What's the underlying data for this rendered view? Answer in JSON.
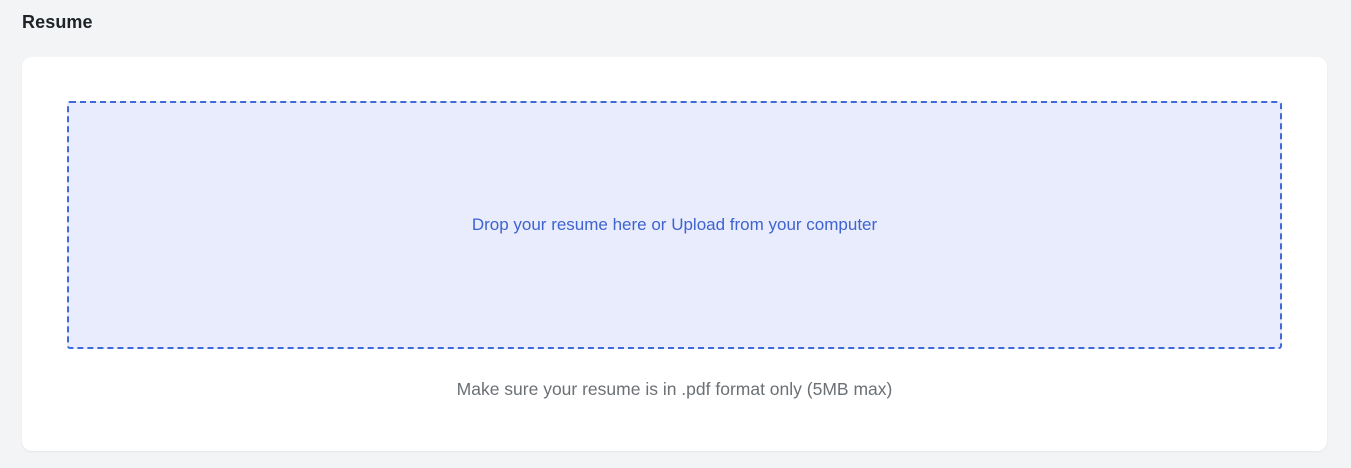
{
  "section": {
    "title": "Resume"
  },
  "upload": {
    "dropzone_label": "Drop your resume here or Upload from your computer",
    "hint": "Make sure your resume is in .pdf format only (5MB max)"
  },
  "colors": {
    "page_background": "#f3f4f6",
    "card_background": "#ffffff",
    "dropzone_background": "#e8ecfc",
    "dropzone_border": "#3f6ad8",
    "accent_text": "#3f63cf",
    "hint_text": "#6b7075"
  }
}
